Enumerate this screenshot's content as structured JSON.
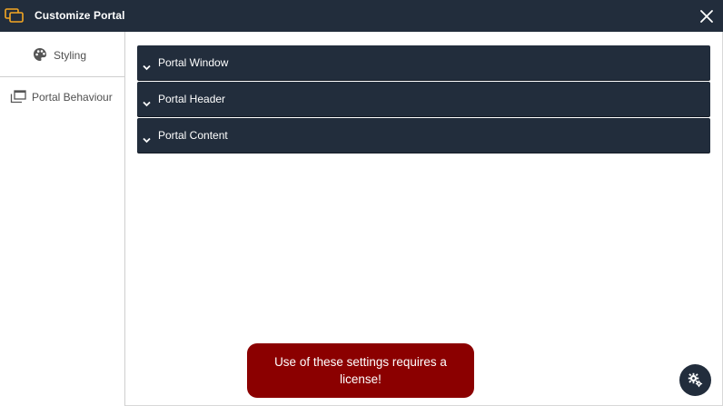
{
  "window": {
    "title": "Customize Portal",
    "app_icon": "portal-windows-icon",
    "close_icon": "close-icon"
  },
  "sidebar": {
    "items": [
      {
        "label": "Styling",
        "icon": "palette-icon",
        "active": true
      },
      {
        "label": "Portal Behaviour",
        "icon": "windows-stack-icon",
        "active": false
      }
    ]
  },
  "panels": [
    {
      "label": "Portal Window",
      "icon": "chevron-down-icon"
    },
    {
      "label": "Portal Header",
      "icon": "chevron-down-icon"
    },
    {
      "label": "Portal Content",
      "icon": "chevron-down-icon"
    }
  ],
  "toast": {
    "message": "Use of these settings requires a license!"
  },
  "fab": {
    "icon": "gear-settings-icon"
  },
  "colors": {
    "dark": "#222d3c",
    "accent": "#f4a623",
    "toast_bg": "#8b0000"
  }
}
